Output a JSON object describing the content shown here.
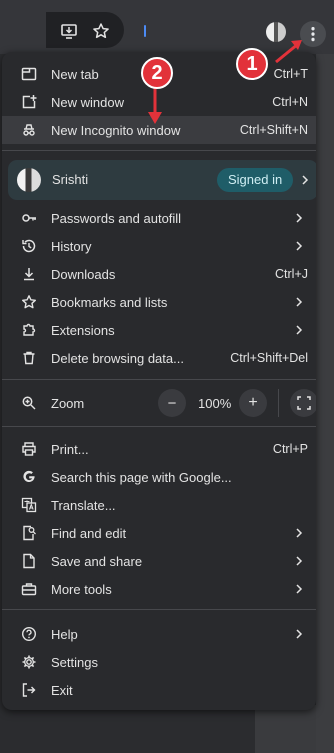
{
  "toolbar": {
    "icons": [
      "install-app-icon",
      "bookmark-star-icon",
      "profile-avatar-icon",
      "more-menu-icon"
    ]
  },
  "callouts": {
    "one": "1",
    "two": "2"
  },
  "menu": {
    "new_tab": {
      "label": "New tab",
      "shortcut": "Ctrl+T"
    },
    "new_window": {
      "label": "New window",
      "shortcut": "Ctrl+N"
    },
    "new_incognito": {
      "label": "New Incognito window",
      "shortcut": "Ctrl+Shift+N"
    },
    "profile": {
      "name": "Srishti",
      "status": "Signed in"
    },
    "passwords": {
      "label": "Passwords and autofill"
    },
    "history": {
      "label": "History"
    },
    "downloads": {
      "label": "Downloads",
      "shortcut": "Ctrl+J"
    },
    "bookmarks": {
      "label": "Bookmarks and lists"
    },
    "extensions": {
      "label": "Extensions"
    },
    "delete_data": {
      "label": "Delete browsing data...",
      "shortcut": "Ctrl+Shift+Del"
    },
    "zoom": {
      "label": "Zoom",
      "minus": "−",
      "value": "100%",
      "plus": "+"
    },
    "print": {
      "label": "Print...",
      "shortcut": "Ctrl+P"
    },
    "search_google": {
      "label": "Search this page with Google..."
    },
    "translate": {
      "label": "Translate..."
    },
    "find_edit": {
      "label": "Find and edit"
    },
    "save_share": {
      "label": "Save and share"
    },
    "more_tools": {
      "label": "More tools"
    },
    "help": {
      "label": "Help"
    },
    "settings": {
      "label": "Settings"
    },
    "exit": {
      "label": "Exit"
    }
  },
  "colors": {
    "callout": "#e2323a",
    "signed_in_badge": "#1f5d68",
    "menu_bg": "#292a2d"
  }
}
